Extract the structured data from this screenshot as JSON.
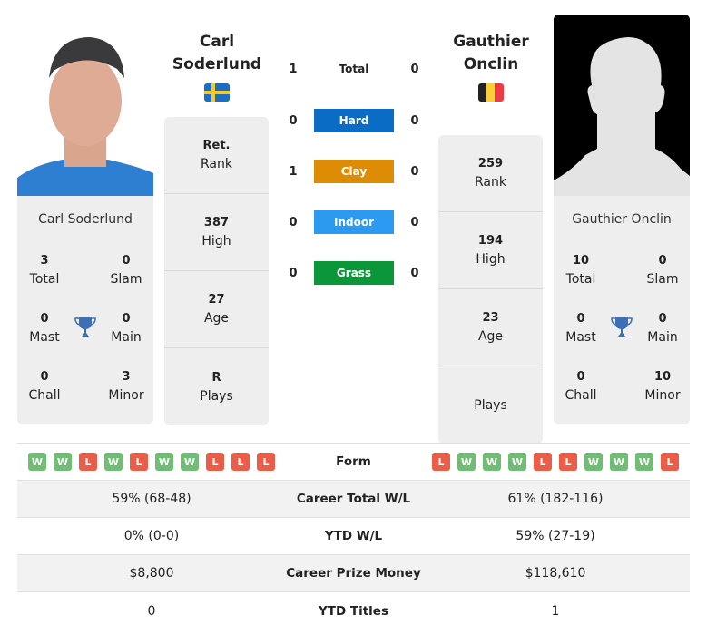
{
  "player1": {
    "name_line1": "Carl",
    "name_line2": "Soderlund",
    "full_name": "Carl Soderlund",
    "country_flag": "sweden-flag",
    "titles": {
      "total": "3",
      "total_label": "Total",
      "slam": "0",
      "slam_label": "Slam",
      "mast": "0",
      "mast_label": "Mast",
      "main": "0",
      "main_label": "Main",
      "chall": "0",
      "chall_label": "Chall",
      "minor": "3",
      "minor_label": "Minor"
    },
    "stats": [
      {
        "value": "Ret.",
        "label": "Rank"
      },
      {
        "value": "387",
        "label": "High"
      },
      {
        "value": "27",
        "label": "Age"
      },
      {
        "value": "R",
        "label": "Plays"
      }
    ],
    "form": [
      "W",
      "W",
      "L",
      "W",
      "L",
      "W",
      "W",
      "L",
      "L",
      "L"
    ]
  },
  "player2": {
    "name_line1": "Gauthier",
    "name_line2": "Onclin",
    "full_name": "Gauthier Onclin",
    "country_flag": "belgium-flag",
    "titles": {
      "total": "10",
      "total_label": "Total",
      "slam": "0",
      "slam_label": "Slam",
      "mast": "0",
      "mast_label": "Mast",
      "main": "0",
      "main_label": "Main",
      "chall": "0",
      "chall_label": "Chall",
      "minor": "10",
      "minor_label": "Minor"
    },
    "stats": [
      {
        "value": "259",
        "label": "Rank"
      },
      {
        "value": "194",
        "label": "High"
      },
      {
        "value": "23",
        "label": "Age"
      },
      {
        "value": "",
        "label": "Plays"
      }
    ],
    "form": [
      "L",
      "W",
      "W",
      "W",
      "L",
      "L",
      "W",
      "W",
      "W",
      "L"
    ]
  },
  "h2h": [
    {
      "surface": "Total",
      "p1": "1",
      "p2": "0",
      "color": ""
    },
    {
      "surface": "Hard",
      "p1": "0",
      "p2": "0",
      "color": "#0a6cc4"
    },
    {
      "surface": "Clay",
      "p1": "1",
      "p2": "0",
      "color": "#de8c05"
    },
    {
      "surface": "Indoor",
      "p1": "0",
      "p2": "0",
      "color": "#2b9af0"
    },
    {
      "surface": "Grass",
      "p1": "0",
      "p2": "0",
      "color": "#0c963a"
    }
  ],
  "comparison": {
    "form_label": "Form",
    "rows": [
      {
        "label": "Career Total W/L",
        "p1": "59% (68-48)",
        "p2": "61% (182-116)"
      },
      {
        "label": "YTD W/L",
        "p1": "0% (0-0)",
        "p2": "59% (27-19)"
      },
      {
        "label": "Career Prize Money",
        "p1": "$8,800",
        "p2": "$118,610"
      },
      {
        "label": "YTD Titles",
        "p1": "0",
        "p2": "1"
      }
    ]
  },
  "colors": {
    "win": "#72bd75",
    "loss": "#ea5d49",
    "trophy": "#3d6fb6"
  }
}
